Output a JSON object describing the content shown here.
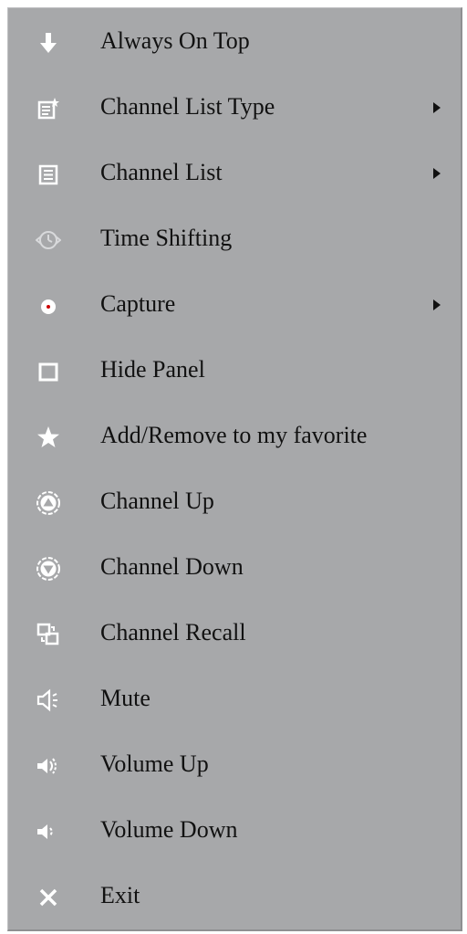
{
  "menu": {
    "items": [
      {
        "label": "Always On Top",
        "icon": "down-arrow-icon",
        "has_submenu": false
      },
      {
        "label": "Channel List Type",
        "icon": "list-type-icon",
        "has_submenu": true
      },
      {
        "label": "Channel List",
        "icon": "list-icon",
        "has_submenu": true
      },
      {
        "label": "Time Shifting",
        "icon": "time-shift-icon",
        "has_submenu": false
      },
      {
        "label": "Capture",
        "icon": "record-icon",
        "has_submenu": true
      },
      {
        "label": "Hide Panel",
        "icon": "panel-icon",
        "has_submenu": false
      },
      {
        "label": "Add/Remove to my favorite",
        "icon": "star-icon",
        "has_submenu": false
      },
      {
        "label": "Channel Up",
        "icon": "up-circle-icon",
        "has_submenu": false
      },
      {
        "label": "Channel Down",
        "icon": "down-circle-icon",
        "has_submenu": false
      },
      {
        "label": "Channel Recall",
        "icon": "recall-icon",
        "has_submenu": false
      },
      {
        "label": "Mute",
        "icon": "mute-speaker-icon",
        "has_submenu": false
      },
      {
        "label": "Volume Up",
        "icon": "volume-up-icon",
        "has_submenu": false
      },
      {
        "label": "Volume Down",
        "icon": "volume-down-icon",
        "has_submenu": false
      },
      {
        "label": "Exit",
        "icon": "close-icon",
        "has_submenu": false
      }
    ]
  },
  "colors": {
    "menu_background": "#a7a8aa",
    "text": "#111111",
    "icon": "#ffffff",
    "capture_dot": "#cc0000"
  }
}
